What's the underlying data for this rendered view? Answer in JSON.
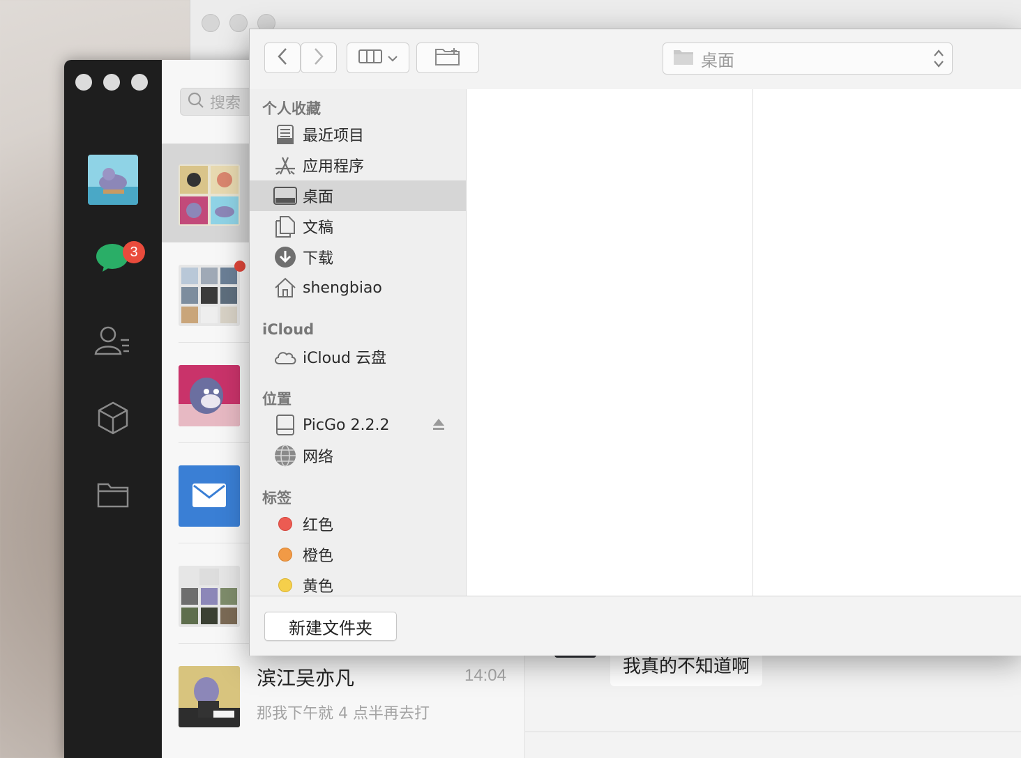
{
  "wechat": {
    "unread_count": "3",
    "search_placeholder": "搜索",
    "chat": {
      "name": "滨江吴亦凡",
      "time": "14:04",
      "preview": "那我下午就 4 点半再去打"
    },
    "message_bubble": "我真的不知道啊"
  },
  "dialog": {
    "path_label": "桌面",
    "sidebar": {
      "favorites_header": "个人收藏",
      "favorites": [
        {
          "label": "最近项目",
          "icon": "recents-icon"
        },
        {
          "label": "应用程序",
          "icon": "applications-icon"
        },
        {
          "label": "桌面",
          "icon": "desktop-icon",
          "selected": true
        },
        {
          "label": "文稿",
          "icon": "documents-icon"
        },
        {
          "label": "下载",
          "icon": "downloads-icon"
        },
        {
          "label": "shengbiao",
          "icon": "home-icon"
        }
      ],
      "icloud_header": "iCloud",
      "icloud": [
        {
          "label": "iCloud 云盘",
          "icon": "cloud-icon"
        }
      ],
      "locations_header": "位置",
      "locations": [
        {
          "label": "PicGo 2.2.2",
          "icon": "disk-icon",
          "ejectable": true
        },
        {
          "label": "网络",
          "icon": "network-icon"
        }
      ],
      "tags_header": "标签",
      "tags": [
        {
          "label": "红色",
          "color": "#ec5b52"
        },
        {
          "label": "橙色",
          "color": "#f19a46"
        },
        {
          "label": "黄色",
          "color": "#f5cf4b"
        }
      ]
    },
    "new_folder_button": "新建文件夹"
  },
  "colors": {
    "wechat_green": "#2aae67",
    "badge_red": "#e94b3c",
    "mail_blue": "#3a7fd5"
  }
}
